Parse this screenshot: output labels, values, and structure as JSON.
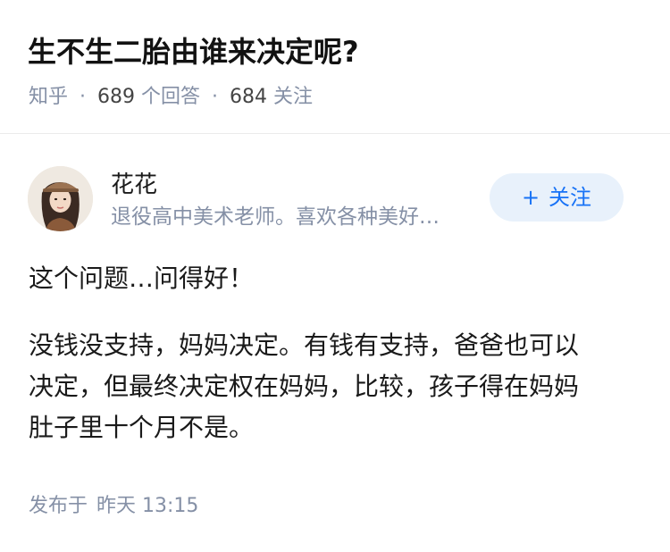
{
  "question": {
    "title": "生不生二胎由谁来决定呢?",
    "source": "知乎",
    "sep": "·",
    "answer_count": "689",
    "answer_label": "个回答",
    "follower_count": "684",
    "follower_label": "关注"
  },
  "author": {
    "name": "花花",
    "bio": "退役高中美术老师。喜欢各种美好…",
    "follow_icon": "plus-icon",
    "follow_plus": "+",
    "follow_label": "关注"
  },
  "answer": {
    "paragraph_1": "这个问题…问得好！",
    "paragraph_2_line_1": "没钱没支持，妈妈决定。有钱有支持，爸爸也可以",
    "paragraph_2_line_2": "决定，但最终决定权在妈妈，比较，孩子得在妈妈",
    "paragraph_2_line_3": "肚子里十个月不是。"
  },
  "footer": {
    "published_label": "发布于",
    "published_time": "昨天 13:15"
  },
  "colors": {
    "accent": "#1772f6",
    "follow_bg": "#e8f1fb",
    "meta": "#8590a6"
  }
}
